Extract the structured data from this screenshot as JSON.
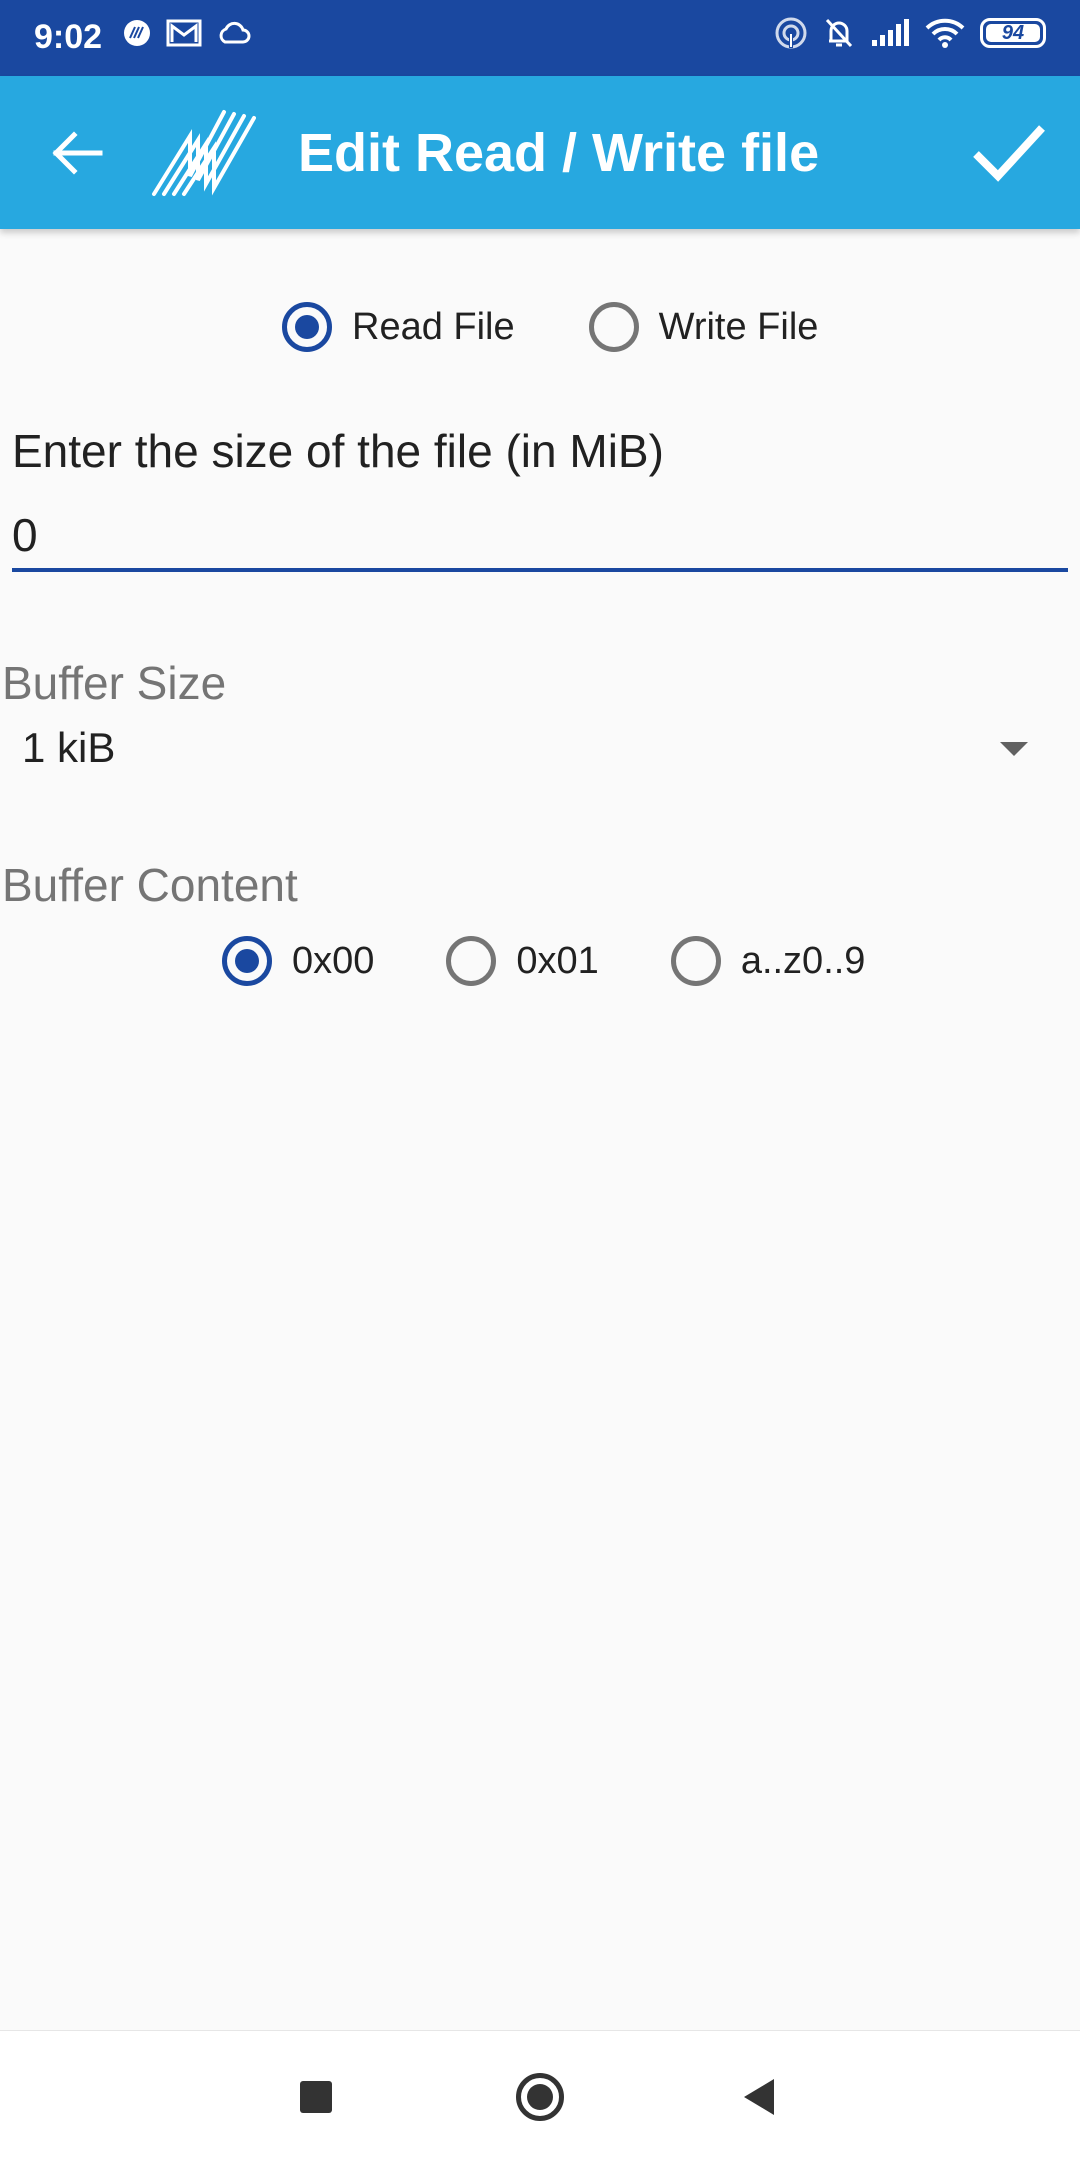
{
  "status_bar": {
    "time": "9:02",
    "battery_level": "94",
    "left_icons": [
      "app-notification-icon",
      "gmail-icon",
      "cloud-icon"
    ],
    "right_icons": [
      "hotspot-icon",
      "bell-off-icon",
      "signal-icon",
      "wifi-icon",
      "battery-icon"
    ]
  },
  "app_bar": {
    "title": "Edit Read / Write file",
    "back_icon": "arrow-left-icon",
    "logo_icon": "app-logo-icon",
    "confirm_icon": "check-icon"
  },
  "mode": {
    "options": [
      {
        "label": "Read File",
        "selected": true
      },
      {
        "label": "Write File",
        "selected": false
      }
    ]
  },
  "file_size": {
    "label": "Enter the size of the file (in MiB)",
    "value": "0"
  },
  "buffer_size": {
    "label": "Buffer Size",
    "selected": "1 kiB"
  },
  "buffer_content": {
    "label": "Buffer Content",
    "options": [
      {
        "label": "0x00",
        "selected": true
      },
      {
        "label": "0x01",
        "selected": false
      },
      {
        "label": "a..z0..9",
        "selected": false
      }
    ]
  },
  "colors": {
    "status_bar": "#1a48a0",
    "app_bar": "#27a8e0",
    "accent": "#1a48a0"
  }
}
